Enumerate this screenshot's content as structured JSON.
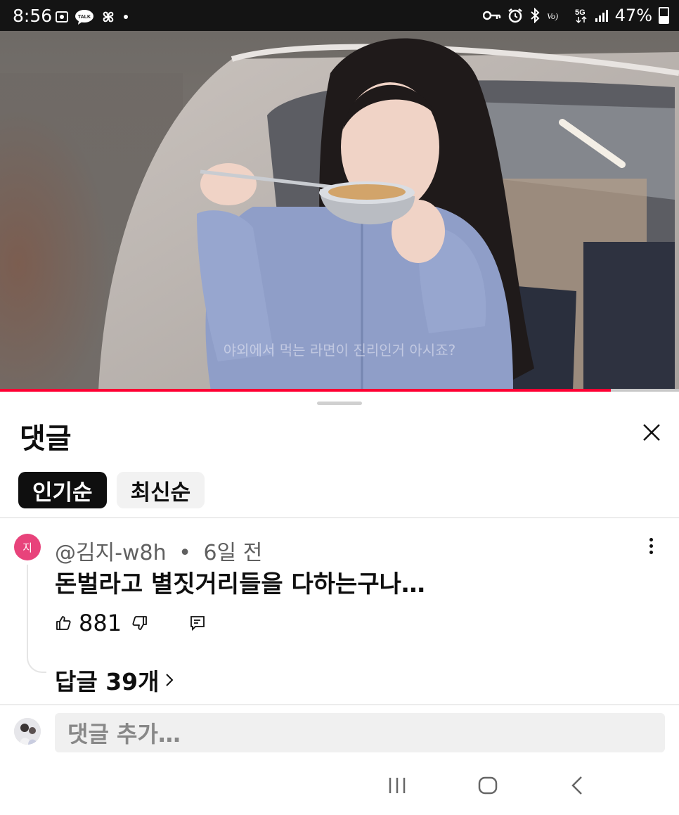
{
  "status_bar": {
    "time": "8:56",
    "left_icons": [
      "screen-record-icon",
      "kakaotalk-icon",
      "message-bubble-icon",
      "pinwheel-icon"
    ],
    "talk_label": "TALK",
    "right_icons": [
      "vpn-key-icon",
      "alarm-icon",
      "bluetooth-icon",
      "volte-icon",
      "5g-icon",
      "signal-icon"
    ],
    "volte_label": "Vo)",
    "network_label": "5G",
    "battery": "47%"
  },
  "video": {
    "subtitle": "야외에서 먹는 라면이 진리인거 아시죠?",
    "progress": 0.9
  },
  "comments_sheet": {
    "title": "댓글",
    "filters": [
      {
        "label": "인기순",
        "active": true
      },
      {
        "label": "최신순",
        "active": false
      }
    ],
    "comment": {
      "avatar_letter": "지",
      "avatar_color": "#e8437b",
      "author": "@김지-w8h",
      "separator": "•",
      "time": "6일 전",
      "text": "돈벌라고 별짓거리들을 다하는구나…",
      "likes": "881",
      "replies_label": "답글 39개"
    },
    "add_comment_placeholder": "댓글 추가…"
  },
  "colors": {
    "accent": "#ff0033",
    "chip_active_bg": "#0f0f0f",
    "chip_inactive_bg": "#f2f2f2"
  }
}
